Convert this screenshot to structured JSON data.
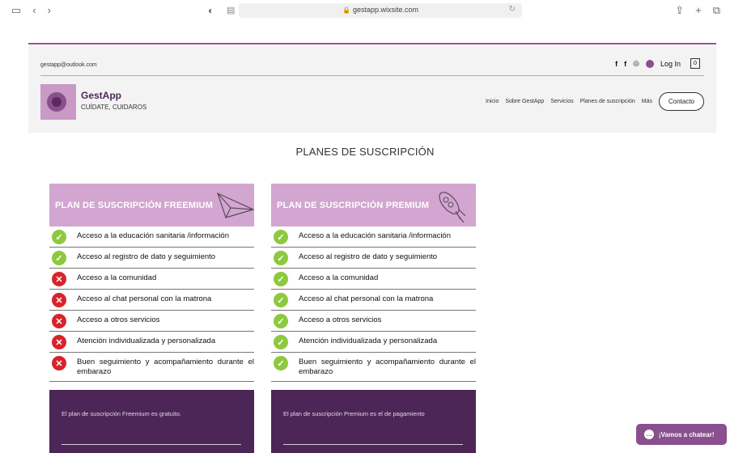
{
  "browser": {
    "url": "gestapp.wixsite.com"
  },
  "header": {
    "email": "gestapp@outlook.com",
    "social": {
      "facebook1": "f",
      "facebook2": "f",
      "instagram": "◎",
      "login": "Log In",
      "cart_count": "0"
    },
    "brand": "GestApp",
    "tagline": "CUÍDATE, CUIDAROS",
    "nav": [
      "Inicio",
      "Sobre GestApp",
      "Servicios",
      "Planes de suscripción",
      "Más"
    ],
    "contact": "Contacto"
  },
  "page": {
    "title": "PLANES DE SUSCRIPCIÓN"
  },
  "plans": [
    {
      "title": "PLAN DE SUSCRIPCIÓN FREEMIUM",
      "icon": "paper-plane-icon",
      "features": [
        {
          "text": "Acceso a la educación sanitaria /información",
          "included": true
        },
        {
          "text": "Acceso al registro de dato y seguimiento",
          "included": true
        },
        {
          "text": "Acceso a la comunidad",
          "included": false
        },
        {
          "text": "Acceso al chat personal con la matrona",
          "included": false
        },
        {
          "text": "Acceso a otros servicios",
          "included": false
        },
        {
          "text": "Atención individualizada y personalizada",
          "included": false
        },
        {
          "text": "Buen seguimiento y acompañamiento durante el embarazo",
          "included": false
        }
      ],
      "footer": "El plan de suscripción Freemium es gratuito."
    },
    {
      "title": "PLAN DE SUSCRIPCIÓN PREMIUM",
      "icon": "rocket-icon",
      "features": [
        {
          "text": "Acceso a la educación sanitaria /información",
          "included": true
        },
        {
          "text": "Acceso al registro de dato y seguimiento",
          "included": true
        },
        {
          "text": "Acceso a la comunidad",
          "included": true
        },
        {
          "text": "Acceso al chat personal con la matrona",
          "included": true
        },
        {
          "text": "Acceso a otros servicios",
          "included": true
        },
        {
          "text": "Atención individualizada y personalizada",
          "included": true
        },
        {
          "text": "Buen seguimiento y acompañamiento durante el embarazo",
          "included": true
        }
      ],
      "footer": "El plan de suscripción Premium es el de pagamiento"
    }
  ],
  "chat": {
    "label": "¡Vamos a chatear!"
  },
  "colors": {
    "brand": "#8a4f8e",
    "plan_header": "#d2a6d0",
    "plan_footer": "#4b2656",
    "check": "#8dc93e",
    "cross": "#d9232a"
  }
}
